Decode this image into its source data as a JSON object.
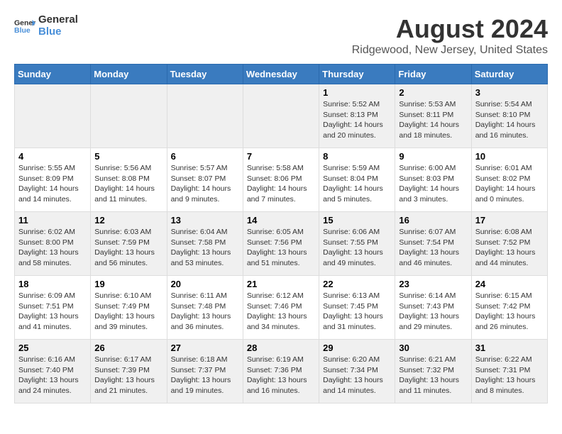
{
  "header": {
    "logo_line1": "General",
    "logo_line2": "Blue",
    "title": "August 2024",
    "subtitle": "Ridgewood, New Jersey, United States"
  },
  "weekdays": [
    "Sunday",
    "Monday",
    "Tuesday",
    "Wednesday",
    "Thursday",
    "Friday",
    "Saturday"
  ],
  "weeks": [
    [
      {
        "day": "",
        "info": ""
      },
      {
        "day": "",
        "info": ""
      },
      {
        "day": "",
        "info": ""
      },
      {
        "day": "",
        "info": ""
      },
      {
        "day": "1",
        "info": "Sunrise: 5:52 AM\nSunset: 8:13 PM\nDaylight: 14 hours\nand 20 minutes."
      },
      {
        "day": "2",
        "info": "Sunrise: 5:53 AM\nSunset: 8:11 PM\nDaylight: 14 hours\nand 18 minutes."
      },
      {
        "day": "3",
        "info": "Sunrise: 5:54 AM\nSunset: 8:10 PM\nDaylight: 14 hours\nand 16 minutes."
      }
    ],
    [
      {
        "day": "4",
        "info": "Sunrise: 5:55 AM\nSunset: 8:09 PM\nDaylight: 14 hours\nand 14 minutes."
      },
      {
        "day": "5",
        "info": "Sunrise: 5:56 AM\nSunset: 8:08 PM\nDaylight: 14 hours\nand 11 minutes."
      },
      {
        "day": "6",
        "info": "Sunrise: 5:57 AM\nSunset: 8:07 PM\nDaylight: 14 hours\nand 9 minutes."
      },
      {
        "day": "7",
        "info": "Sunrise: 5:58 AM\nSunset: 8:06 PM\nDaylight: 14 hours\nand 7 minutes."
      },
      {
        "day": "8",
        "info": "Sunrise: 5:59 AM\nSunset: 8:04 PM\nDaylight: 14 hours\nand 5 minutes."
      },
      {
        "day": "9",
        "info": "Sunrise: 6:00 AM\nSunset: 8:03 PM\nDaylight: 14 hours\nand 3 minutes."
      },
      {
        "day": "10",
        "info": "Sunrise: 6:01 AM\nSunset: 8:02 PM\nDaylight: 14 hours\nand 0 minutes."
      }
    ],
    [
      {
        "day": "11",
        "info": "Sunrise: 6:02 AM\nSunset: 8:00 PM\nDaylight: 13 hours\nand 58 minutes."
      },
      {
        "day": "12",
        "info": "Sunrise: 6:03 AM\nSunset: 7:59 PM\nDaylight: 13 hours\nand 56 minutes."
      },
      {
        "day": "13",
        "info": "Sunrise: 6:04 AM\nSunset: 7:58 PM\nDaylight: 13 hours\nand 53 minutes."
      },
      {
        "day": "14",
        "info": "Sunrise: 6:05 AM\nSunset: 7:56 PM\nDaylight: 13 hours\nand 51 minutes."
      },
      {
        "day": "15",
        "info": "Sunrise: 6:06 AM\nSunset: 7:55 PM\nDaylight: 13 hours\nand 49 minutes."
      },
      {
        "day": "16",
        "info": "Sunrise: 6:07 AM\nSunset: 7:54 PM\nDaylight: 13 hours\nand 46 minutes."
      },
      {
        "day": "17",
        "info": "Sunrise: 6:08 AM\nSunset: 7:52 PM\nDaylight: 13 hours\nand 44 minutes."
      }
    ],
    [
      {
        "day": "18",
        "info": "Sunrise: 6:09 AM\nSunset: 7:51 PM\nDaylight: 13 hours\nand 41 minutes."
      },
      {
        "day": "19",
        "info": "Sunrise: 6:10 AM\nSunset: 7:49 PM\nDaylight: 13 hours\nand 39 minutes."
      },
      {
        "day": "20",
        "info": "Sunrise: 6:11 AM\nSunset: 7:48 PM\nDaylight: 13 hours\nand 36 minutes."
      },
      {
        "day": "21",
        "info": "Sunrise: 6:12 AM\nSunset: 7:46 PM\nDaylight: 13 hours\nand 34 minutes."
      },
      {
        "day": "22",
        "info": "Sunrise: 6:13 AM\nSunset: 7:45 PM\nDaylight: 13 hours\nand 31 minutes."
      },
      {
        "day": "23",
        "info": "Sunrise: 6:14 AM\nSunset: 7:43 PM\nDaylight: 13 hours\nand 29 minutes."
      },
      {
        "day": "24",
        "info": "Sunrise: 6:15 AM\nSunset: 7:42 PM\nDaylight: 13 hours\nand 26 minutes."
      }
    ],
    [
      {
        "day": "25",
        "info": "Sunrise: 6:16 AM\nSunset: 7:40 PM\nDaylight: 13 hours\nand 24 minutes."
      },
      {
        "day": "26",
        "info": "Sunrise: 6:17 AM\nSunset: 7:39 PM\nDaylight: 13 hours\nand 21 minutes."
      },
      {
        "day": "27",
        "info": "Sunrise: 6:18 AM\nSunset: 7:37 PM\nDaylight: 13 hours\nand 19 minutes."
      },
      {
        "day": "28",
        "info": "Sunrise: 6:19 AM\nSunset: 7:36 PM\nDaylight: 13 hours\nand 16 minutes."
      },
      {
        "day": "29",
        "info": "Sunrise: 6:20 AM\nSunset: 7:34 PM\nDaylight: 13 hours\nand 14 minutes."
      },
      {
        "day": "30",
        "info": "Sunrise: 6:21 AM\nSunset: 7:32 PM\nDaylight: 13 hours\nand 11 minutes."
      },
      {
        "day": "31",
        "info": "Sunrise: 6:22 AM\nSunset: 7:31 PM\nDaylight: 13 hours\nand 8 minutes."
      }
    ]
  ]
}
